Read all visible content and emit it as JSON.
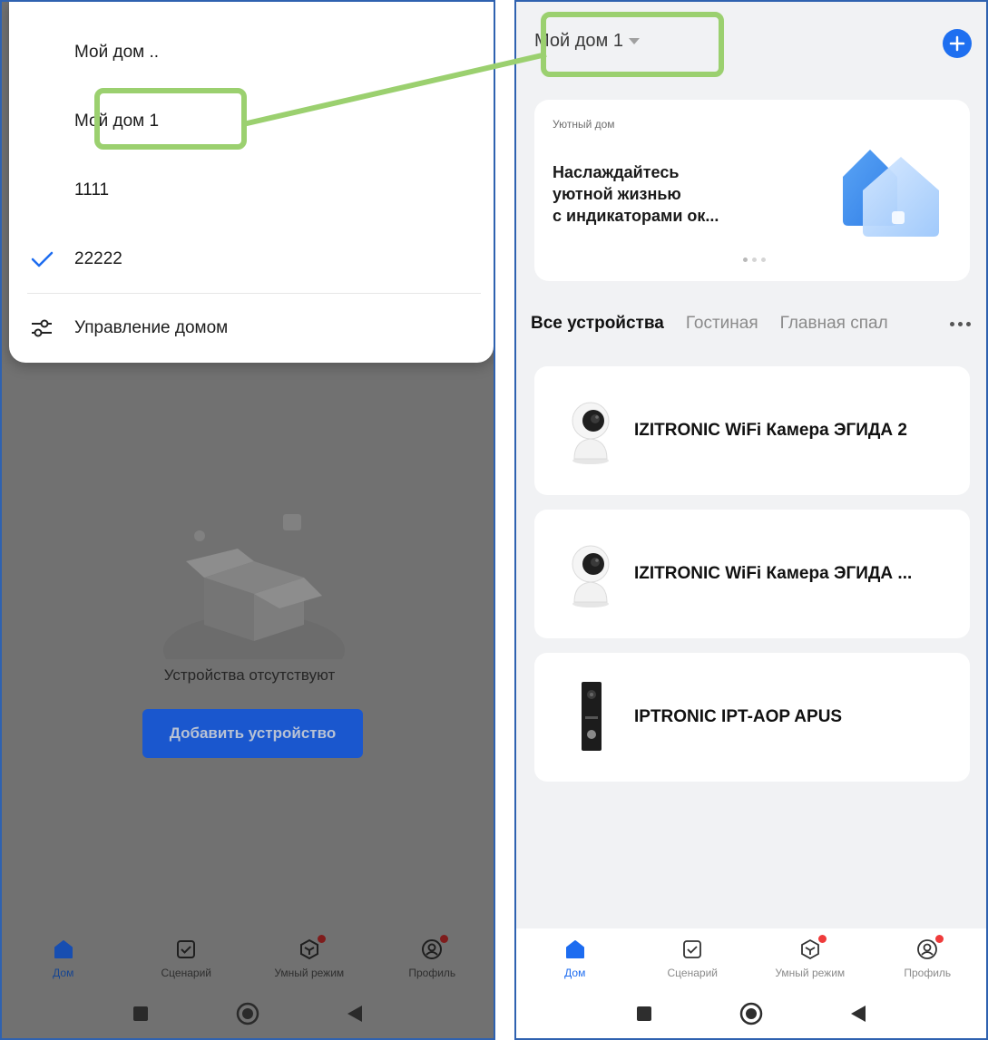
{
  "left": {
    "dropdown": {
      "items": [
        {
          "label": "Мой дом .."
        },
        {
          "label": "Мой дом 1"
        },
        {
          "label": "1111"
        },
        {
          "label": "22222",
          "selected": true
        }
      ],
      "manage_label": "Управление домом"
    },
    "empty_text": "Устройства отсутствуют",
    "add_device_label": "Добавить устройство"
  },
  "right": {
    "home_title": "Мой дом 1",
    "banner": {
      "subtitle": "Уютный дом",
      "title": "Наслаждайтесь\nуютной жизнью\nс индикаторами ок..."
    },
    "tabs": [
      "Все устройства",
      "Гостиная",
      "Главная спал"
    ],
    "devices": [
      {
        "name": "IZITRONIC WiFi Камера ЭГИДА 2",
        "icon": "ptz-camera-icon"
      },
      {
        "name": "IZITRONIC WiFi Камера ЭГИДА ...",
        "icon": "ptz-camera-icon"
      },
      {
        "name": "IPTRONIC IPT-AOP APUS",
        "icon": "doorbell-panel-icon"
      }
    ]
  },
  "nav": {
    "items": [
      {
        "label": "Дом",
        "icon": "home-icon",
        "active": true
      },
      {
        "label": "Сценарий",
        "icon": "scenario-icon"
      },
      {
        "label": "Умный режим",
        "icon": "smart-mode-icon",
        "badge": true
      },
      {
        "label": "Профиль",
        "icon": "profile-icon",
        "badge": true
      }
    ]
  },
  "colors": {
    "accent": "#1d6cf0",
    "highlight": "#9bd06f",
    "badge": "#ef3b3b",
    "frame": "#2f62b0"
  }
}
